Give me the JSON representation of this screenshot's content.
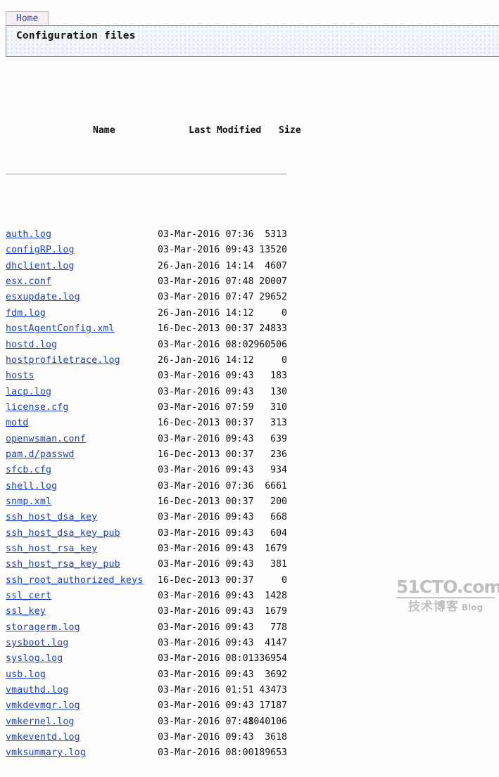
{
  "tabs": [
    {
      "label": "Home"
    }
  ],
  "header": {
    "title": "Configuration files"
  },
  "listing": {
    "columns": {
      "name": "Name",
      "last_modified": "Last Modified",
      "size": "Size"
    },
    "rows": [
      {
        "name": "auth.log",
        "date": "03-Mar-2016 07:36",
        "size": "5313"
      },
      {
        "name": "configRP.log",
        "date": "03-Mar-2016 09:43",
        "size": "13520"
      },
      {
        "name": "dhclient.log",
        "date": "26-Jan-2016 14:14",
        "size": "4607"
      },
      {
        "name": "esx.conf",
        "date": "03-Mar-2016 07:48",
        "size": "20007"
      },
      {
        "name": "esxupdate.log",
        "date": "03-Mar-2016 07:47",
        "size": "29652"
      },
      {
        "name": "fdm.log",
        "date": "26-Jan-2016 14:12",
        "size": "0"
      },
      {
        "name": "hostAgentConfig.xml",
        "date": "16-Dec-2013 00:37",
        "size": "24833"
      },
      {
        "name": "hostd.log",
        "date": "03-Mar-2016 08:02",
        "size": "2960506"
      },
      {
        "name": "hostprofiletrace.log",
        "date": "26-Jan-2016 14:12",
        "size": "0"
      },
      {
        "name": "hosts",
        "date": "03-Mar-2016 09:43",
        "size": "183"
      },
      {
        "name": "lacp.log",
        "date": "03-Mar-2016 09:43",
        "size": "130"
      },
      {
        "name": "license.cfg",
        "date": "03-Mar-2016 07:59",
        "size": "310"
      },
      {
        "name": "motd",
        "date": "16-Dec-2013 00:37",
        "size": "313"
      },
      {
        "name": "openwsman.conf",
        "date": "03-Mar-2016 09:43",
        "size": "639"
      },
      {
        "name": "pam.d/passwd",
        "date": "16-Dec-2013 00:37",
        "size": "236"
      },
      {
        "name": "sfcb.cfg",
        "date": "03-Mar-2016 09:43",
        "size": "934"
      },
      {
        "name": "shell.log",
        "date": "03-Mar-2016 07:36",
        "size": "6661"
      },
      {
        "name": "snmp.xml",
        "date": "16-Dec-2013 00:37",
        "size": "200"
      },
      {
        "name": "ssh_host_dsa_key",
        "date": "03-Mar-2016 09:43",
        "size": "668"
      },
      {
        "name": "ssh_host_dsa_key_pub",
        "date": "03-Mar-2016 09:43",
        "size": "604"
      },
      {
        "name": "ssh_host_rsa_key",
        "date": "03-Mar-2016 09:43",
        "size": "1679"
      },
      {
        "name": "ssh_host_rsa_key_pub",
        "date": "03-Mar-2016 09:43",
        "size": "381"
      },
      {
        "name": "ssh_root_authorized_keys",
        "date": "16-Dec-2013 00:37",
        "size": "0"
      },
      {
        "name": "ssl_cert",
        "date": "03-Mar-2016 09:43",
        "size": "1428"
      },
      {
        "name": "ssl_key",
        "date": "03-Mar-2016 09:43",
        "size": "1679"
      },
      {
        "name": "storagerm.log",
        "date": "03-Mar-2016 09:43",
        "size": "778"
      },
      {
        "name": "sysboot.log",
        "date": "03-Mar-2016 09:43",
        "size": "4147"
      },
      {
        "name": "syslog.log",
        "date": "03-Mar-2016 08:01",
        "size": "336954"
      },
      {
        "name": "usb.log",
        "date": "03-Mar-2016 09:43",
        "size": "3692"
      },
      {
        "name": "vmauthd.log",
        "date": "03-Mar-2016 01:51",
        "size": "43473"
      },
      {
        "name": "vmkdevmgr.log",
        "date": "03-Mar-2016 09:43",
        "size": "17187"
      },
      {
        "name": "vmkernel.log",
        "date": "03-Mar-2016 07:48",
        "size": "1040106"
      },
      {
        "name": "vmkeventd.log",
        "date": "03-Mar-2016 09:43",
        "size": "3618"
      },
      {
        "name": "vmksummary.log",
        "date": "03-Mar-2016 08:00",
        "size": "189653"
      }
    ]
  },
  "watermark": {
    "site": "51CTO.com",
    "cn": "技术博客",
    "blog": "Blog"
  },
  "colors": {
    "link": "#1b3fc6",
    "tab_background": "#f7eef1",
    "panel_background": "#eef4f9",
    "page_background": "#fdfdfb"
  }
}
